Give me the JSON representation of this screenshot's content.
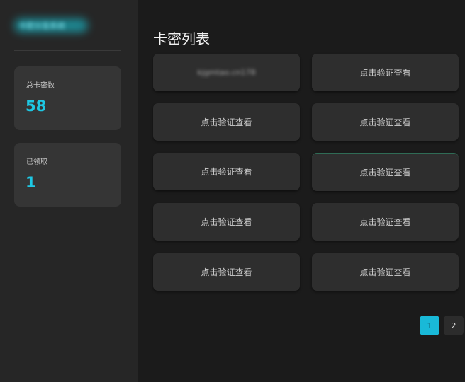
{
  "sidebar": {
    "brand": "卡密分发系统",
    "stats": [
      {
        "label": "总卡密数",
        "value": "58"
      },
      {
        "label": "已领取",
        "value": "1"
      }
    ]
  },
  "main": {
    "title": "卡密列表",
    "cards": [
      {
        "text": "kjgmtao.cn178",
        "blurred": true
      },
      {
        "text": "点击验证查看",
        "blurred": false
      },
      {
        "text": "点击验证查看",
        "blurred": false
      },
      {
        "text": "点击验证查看",
        "blurred": false
      },
      {
        "text": "点击验证查看",
        "blurred": false
      },
      {
        "text": "点击验证查看",
        "blurred": false
      },
      {
        "text": "点击验证查看",
        "blurred": false
      },
      {
        "text": "点击验证查看",
        "blurred": false
      },
      {
        "text": "点击验证查看",
        "blurred": false
      },
      {
        "text": "点击验证查看",
        "blurred": false
      }
    ],
    "pagination": {
      "pages": [
        "1",
        "2"
      ],
      "current": "1"
    }
  },
  "colors": {
    "accent": "#1ec8e4",
    "background": "#1b1b1b",
    "sidebar": "#262626",
    "card": "#2e2e2e"
  }
}
